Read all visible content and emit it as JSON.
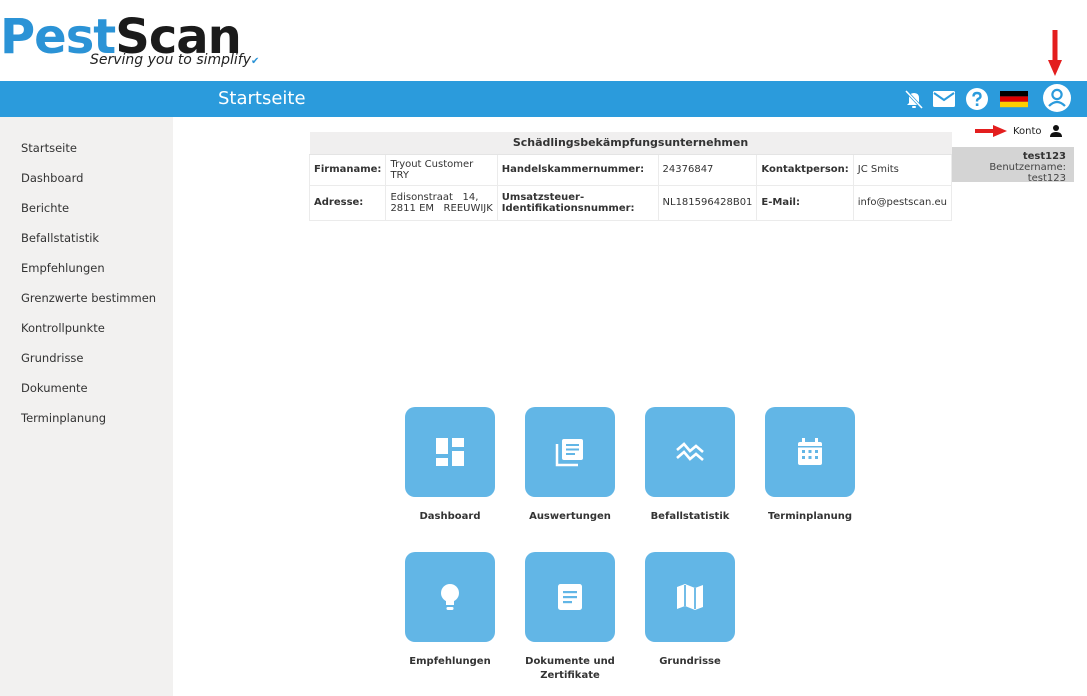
{
  "brand": {
    "logo_part1": "Pest",
    "logo_part2": "Scan",
    "tagline": "Serving you to simplify"
  },
  "topbar": {
    "title": "Startseite",
    "icons": [
      "notifications-off-icon",
      "mail-icon",
      "help-icon",
      "german-flag-icon",
      "account-icon"
    ]
  },
  "sidebar": {
    "items": [
      {
        "label": "Startseite"
      },
      {
        "label": "Dashboard"
      },
      {
        "label": "Berichte"
      },
      {
        "label": "Befallstatistik"
      },
      {
        "label": "Empfehlungen"
      },
      {
        "label": "Grenzwerte bestimmen"
      },
      {
        "label": "Kontrollpunkte"
      },
      {
        "label": "Grundrisse"
      },
      {
        "label": "Dokumente"
      },
      {
        "label": "Terminplanung"
      }
    ]
  },
  "company": {
    "heading": "Schädlingsbekämpfungsunternehmen",
    "firmaname_label": "Firmaname:",
    "firmaname": "Tryout Customer TRY",
    "hk_label": "Handelskammernummer:",
    "hk": "24376847",
    "kontakt_label": "Kontaktperson:",
    "kontakt": "JC Smits",
    "adresse_label": "Adresse:",
    "adresse_line1": "Edisonstraat   14,",
    "adresse_line2": "2811 EM   REEUWIJK",
    "ust_label": "Umsatzsteuer-Identifikationsnummer:",
    "ust": "NL181596428B01",
    "email_label": "E-Mail:",
    "email": "info@pestscan.eu"
  },
  "account": {
    "konto_label": "Konto",
    "username": "test123",
    "login_line": "Benutzername: test123"
  },
  "tiles": [
    {
      "label": "Dashboard",
      "icon": "dashboard-icon"
    },
    {
      "label": "Auswertungen",
      "icon": "library-books-icon"
    },
    {
      "label": "Befallstatistik",
      "icon": "stacked-line-chart-icon"
    },
    {
      "label": "Terminplanung",
      "icon": "calendar-icon"
    },
    {
      "label": "Empfehlungen",
      "icon": "lightbulb-icon"
    },
    {
      "label_line1": "Dokumente und",
      "label_line2": "Zertifikate",
      "icon": "document-icon"
    },
    {
      "label": "Grundrisse",
      "icon": "map-icon"
    }
  ],
  "colors": {
    "accent": "#2b9bdc",
    "tile": "#62b6e6",
    "sidebar_bg": "#f2f1f0",
    "annotation_arrow": "#e31e1e"
  }
}
